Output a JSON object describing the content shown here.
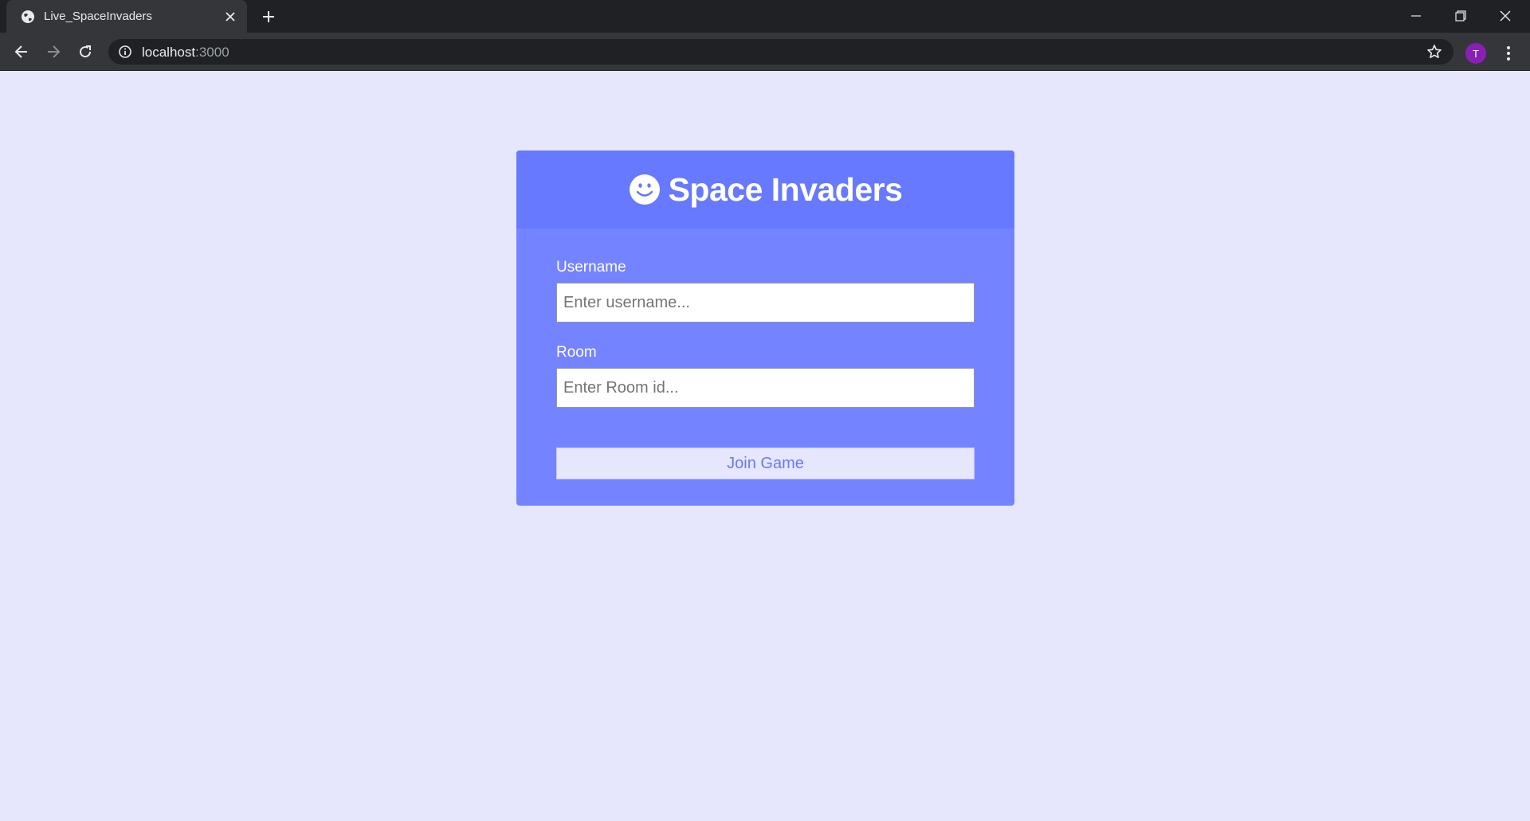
{
  "browser": {
    "tab_title": "Live_SpaceInvaders",
    "url_host": "localhost",
    "url_port": ":3000",
    "avatar_initial": "T"
  },
  "app": {
    "title": "Space Invaders",
    "logo_icon": "smiley-icon",
    "username_label": "Username",
    "username_placeholder": "Enter username...",
    "room_label": "Room",
    "room_placeholder": "Enter Room id...",
    "join_button_label": "Join Game"
  },
  "colors": {
    "page_background": "#e6e7fc",
    "card_background": "#7483ff",
    "card_header": "#6679ff",
    "button_text": "#6679ff",
    "avatar": "#8a1fb5"
  }
}
